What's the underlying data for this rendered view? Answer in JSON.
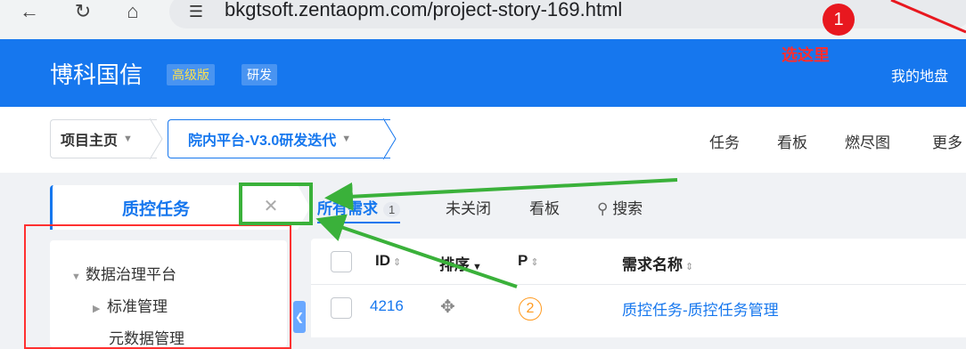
{
  "browser": {
    "url": "bkgtsoft.zentaopm.com/project-story-169.html",
    "back_icon": "arrow-left-icon",
    "reload_icon": "reload-icon",
    "home_icon": "home-icon",
    "site_info_icon": "tune-icon"
  },
  "header": {
    "brand": "博科国信",
    "edition_badge": "高级版",
    "dev_badge": "研发",
    "my_area": "我的地盘",
    "color": "#1677ee"
  },
  "annotation": {
    "number": "1",
    "label": "选这里",
    "color": "#ff2d2d",
    "arrow_color": "#3ab13a"
  },
  "breadcrumb": {
    "home": "项目主页",
    "project": "院内平台-V3.0研发迭代"
  },
  "top_menu": [
    "任务",
    "看板",
    "燃尽图",
    "更多"
  ],
  "module": {
    "title": "质控任务",
    "close_icon": "close-icon"
  },
  "tree": {
    "root": "数据治理平台",
    "children": [
      "标准管理",
      "元数据管理"
    ]
  },
  "filters": {
    "all": "所有需求",
    "all_count": "1",
    "unclosed": "未关闭",
    "kanban": "看板",
    "search": "搜索"
  },
  "table": {
    "columns": [
      "ID",
      "排序",
      "P",
      "需求名称"
    ],
    "rows": [
      {
        "id": "4216",
        "priority": "2",
        "name": "质控任务-质控任务管理"
      }
    ]
  }
}
